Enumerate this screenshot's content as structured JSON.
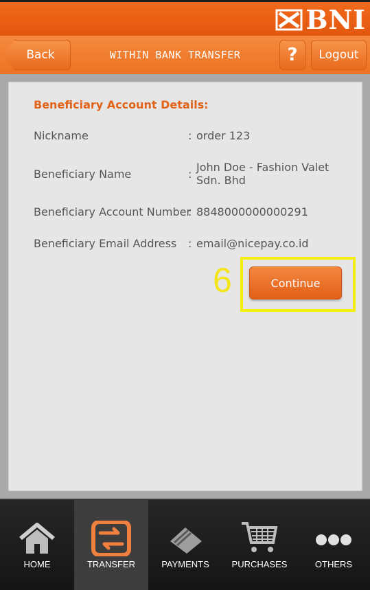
{
  "header": {
    "brand": "BNI",
    "back_label": "Back",
    "title": "WITHIN BANK TRANSFER",
    "help_label": "?",
    "logout_label": "Logout"
  },
  "details": {
    "section_title": "Beneficiary Account Details:",
    "rows": [
      {
        "label": "Nickname",
        "value": "order 123"
      },
      {
        "label": "Beneficiary Name",
        "value": "John Doe - Fashion Valet Sdn. Bhd"
      },
      {
        "label": "Beneficiary Account Number",
        "value": "8848000000000291"
      },
      {
        "label": "Beneficiary Email Address",
        "value": "email@nicepay.co.id"
      }
    ],
    "colon": ":"
  },
  "annotation": {
    "step_number": "6"
  },
  "actions": {
    "continue_label": "Continue"
  },
  "tabs": [
    {
      "label": "HOME",
      "icon": "home-icon",
      "active": false
    },
    {
      "label": "TRANSFER",
      "icon": "transfer-icon",
      "active": true
    },
    {
      "label": "PAYMENTS",
      "icon": "payments-icon",
      "active": false
    },
    {
      "label": "PURCHASES",
      "icon": "cart-icon",
      "active": false
    },
    {
      "label": "OTHERS",
      "icon": "more-icon",
      "active": false
    }
  ],
  "colors": {
    "brand_orange": "#e96a1c",
    "highlight_yellow": "#f5ee14",
    "section_title": "#e2641a"
  }
}
